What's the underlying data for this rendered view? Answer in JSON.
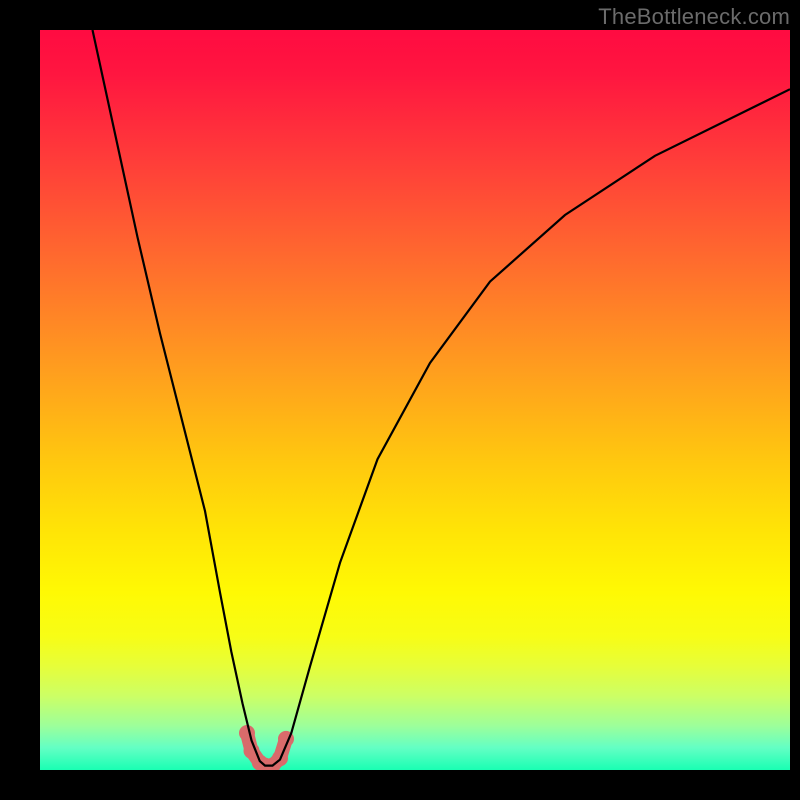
{
  "watermark": "TheBottleneck.com",
  "colors": {
    "background": "#000000",
    "watermark_text": "#6b6b6b",
    "curve_stroke": "#000000",
    "highlight": "#d96b6b",
    "gradient_top": "#ff0b41",
    "gradient_bottom": "#19ffb3"
  },
  "chart_data": {
    "type": "line",
    "title": "",
    "xlabel": "",
    "ylabel": "",
    "xlim": [
      0,
      100
    ],
    "ylim": [
      0,
      100
    ],
    "grid": false,
    "legend": false,
    "note": "V-shaped curve over a vertical red-to-green gradient; minimum marked by a pink U-shaped overlay.",
    "series": [
      {
        "name": "curve",
        "x": [
          7,
          10,
          13,
          16,
          19,
          22,
          24,
          25.5,
          27,
          28.2,
          29.3,
          30,
          31,
          32,
          33.5,
          36,
          40,
          45,
          52,
          60,
          70,
          82,
          94,
          100
        ],
        "y": [
          100,
          86,
          72,
          59,
          47,
          35,
          24,
          16,
          9,
          4,
          1.2,
          0.6,
          0.6,
          1.4,
          5,
          14,
          28,
          42,
          55,
          66,
          75,
          83,
          89,
          92
        ]
      }
    ],
    "highlight": {
      "name": "pink-minimum-overlay",
      "x": [
        27.6,
        28.2,
        29.3,
        30.0,
        31.0,
        32.0,
        32.8
      ],
      "y": [
        5.0,
        2.6,
        1.0,
        0.6,
        0.6,
        1.6,
        4.2
      ]
    }
  }
}
